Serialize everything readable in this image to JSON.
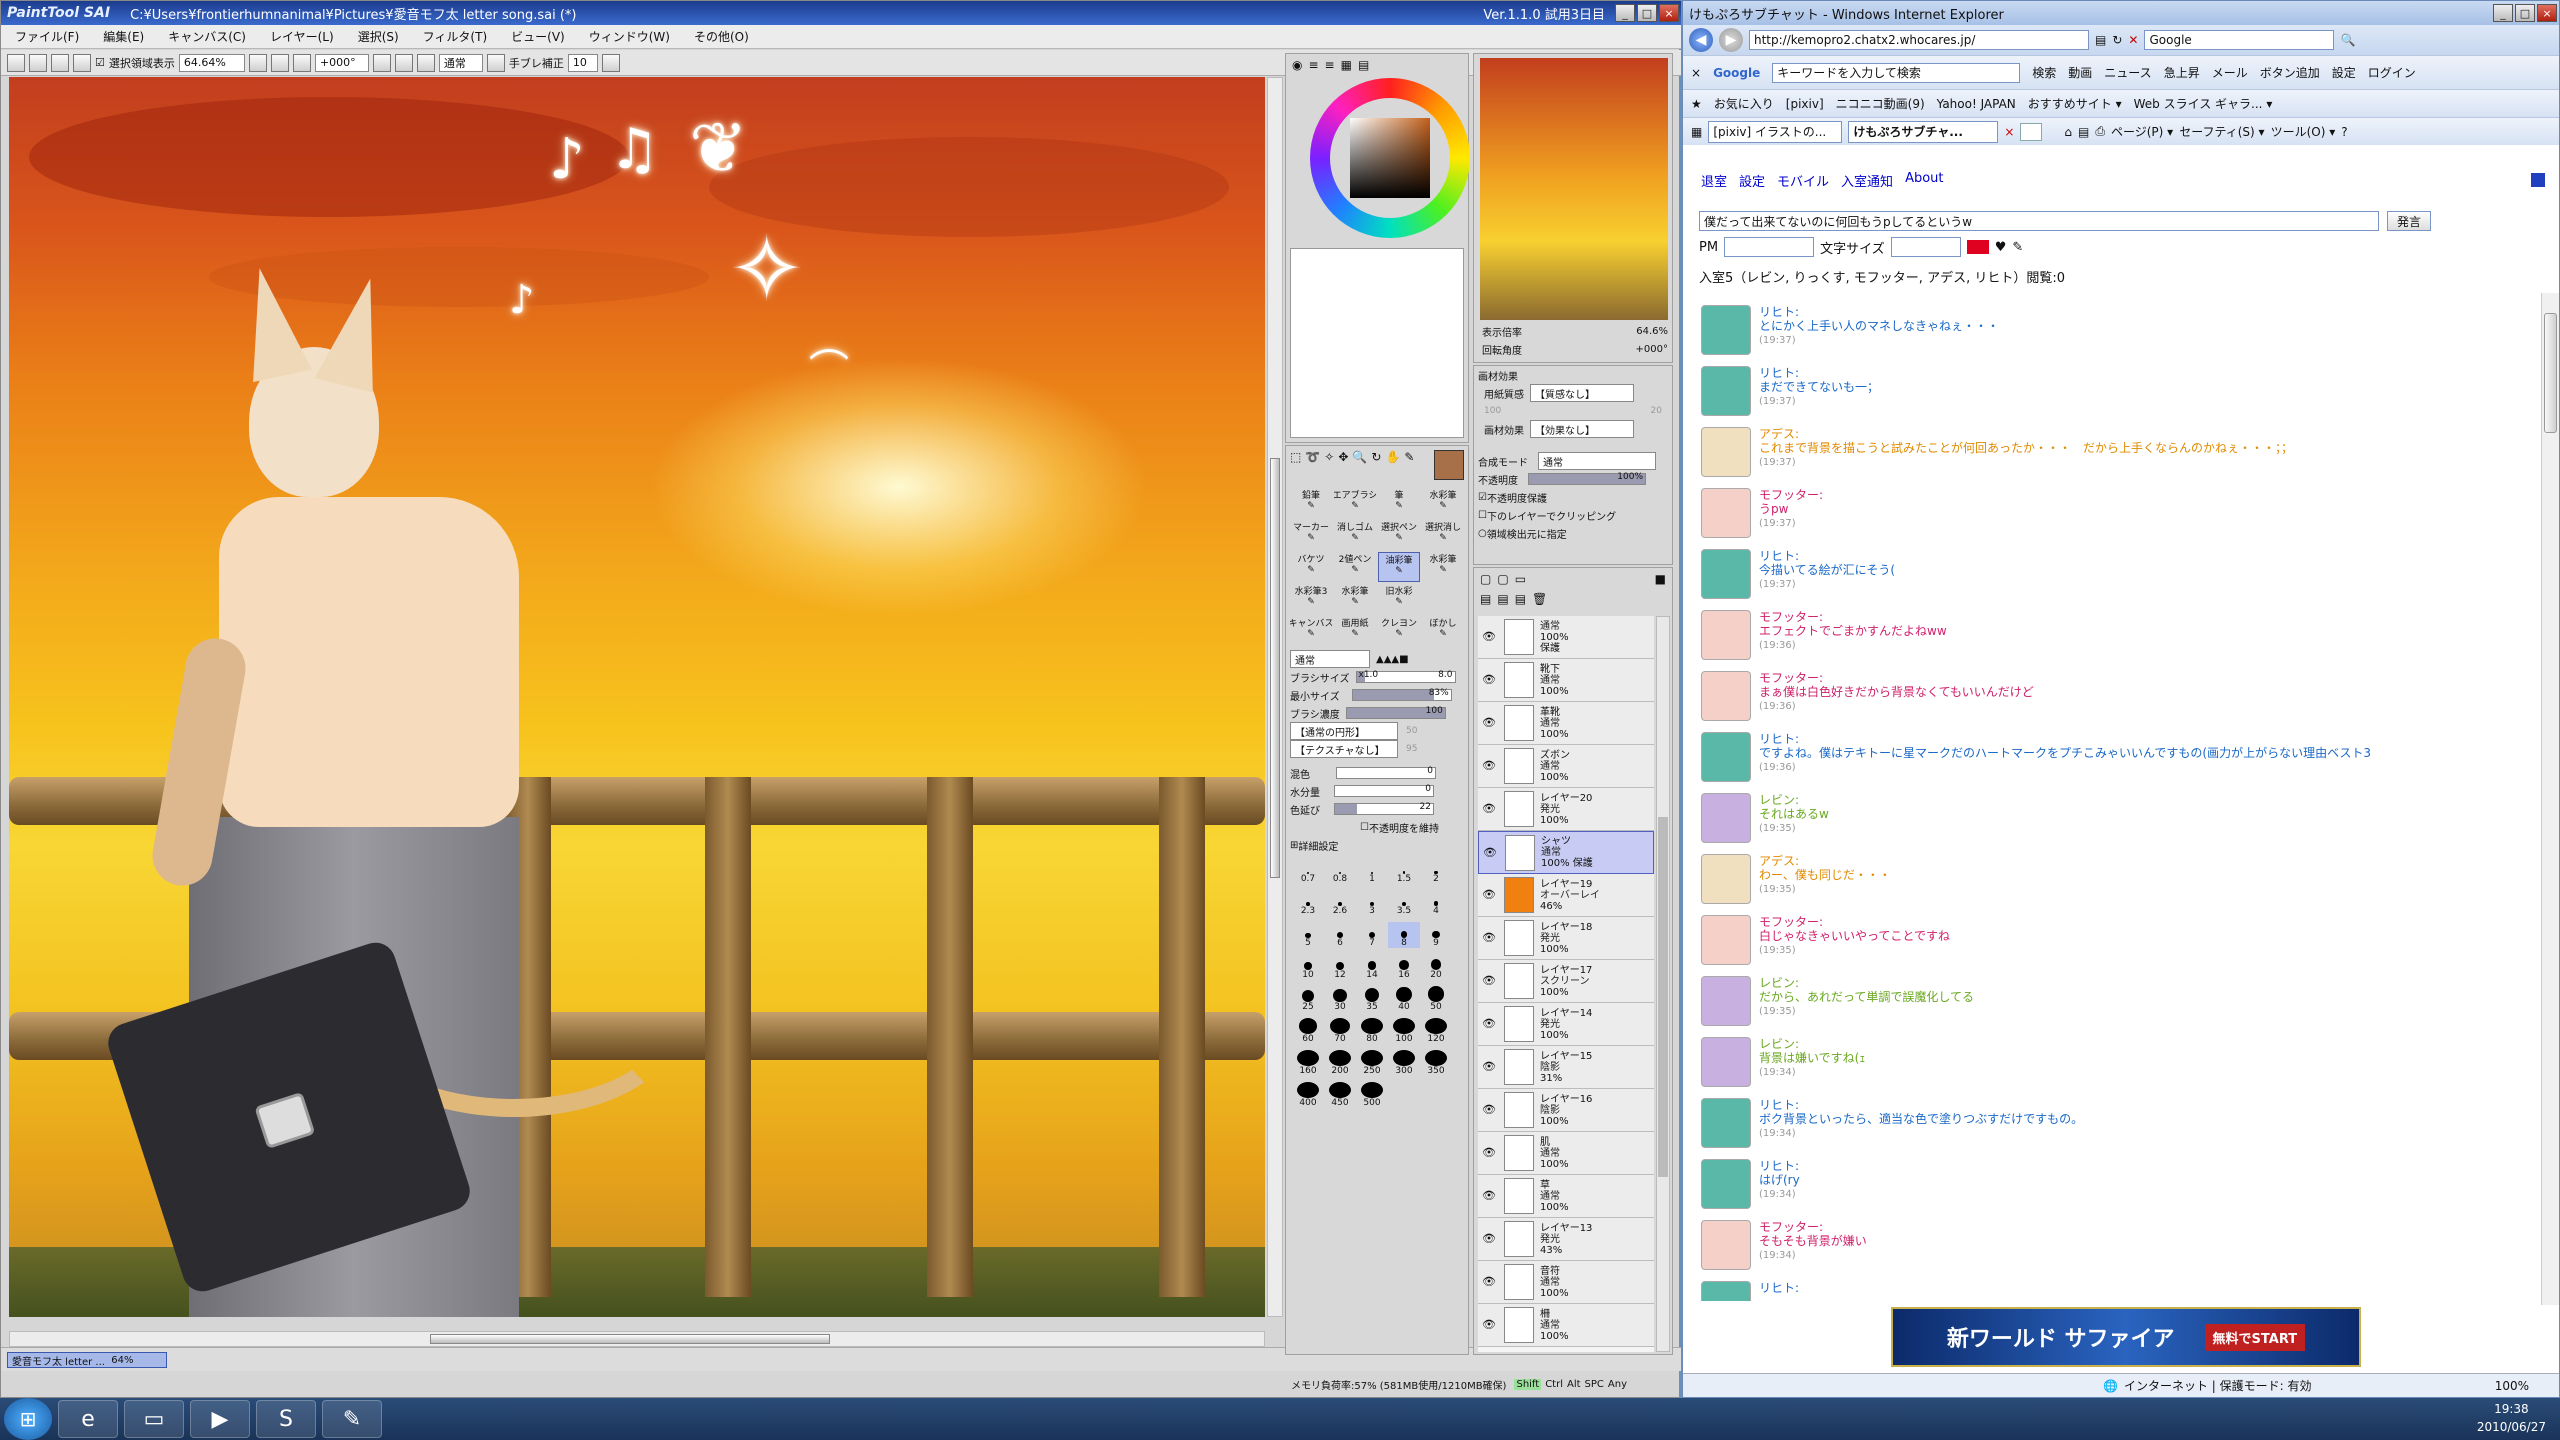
{
  "sai": {
    "logo": "PaintTool SAI",
    "path": "C:¥Users¥frontierhumnanimal¥Pictures¥愛音モフ太  letter song.sai (*)",
    "version": "Ver.1.1.0 試用3日目",
    "menu": [
      "ファイル(F)",
      "編集(E)",
      "キャンバス(C)",
      "レイヤー(L)",
      "選択(S)",
      "フィルタ(T)",
      "ビュー(V)",
      "ウィンドウ(W)",
      "その他(O)"
    ],
    "toolbar": {
      "selection_label": "選択領域表示",
      "zoom": "64.64%",
      "angle": "+000°",
      "blend": "通常",
      "stabilizer_label": "手ブレ補正",
      "stabilizer": "10"
    },
    "navigator": {
      "zoom_label": "表示倍率",
      "zoom": "64.6%",
      "angle_label": "回転角度",
      "angle": "+000°"
    },
    "texture": {
      "header": "画材効果",
      "paper_label": "用紙質感",
      "paper": "【質感なし】",
      "effect_label": "画材効果",
      "effect": "【効果なし】",
      "paper_val1": "100",
      "paper_val2": "20"
    },
    "layer_opts": {
      "blend_label": "合成モード",
      "blend": "通常",
      "opacity_label": "不透明度",
      "opacity": "100%",
      "preserve": "不透明度保護",
      "clip": "下のレイヤーでクリッピング",
      "source": "領域検出元に指定"
    },
    "tools": [
      "鉛筆",
      "エアブラシ",
      "筆",
      "水彩筆",
      "マーカー",
      "消しゴム",
      "選択ペン",
      "選択消し",
      "バケツ",
      "2値ペン",
      "油彩筆",
      "水彩筆",
      "水彩筆3",
      "水彩筆",
      "旧水彩",
      "",
      "キャンバス",
      "画用紙",
      "クレヨン",
      "ぼかし"
    ],
    "brush": {
      "mode": "通常",
      "size_label": "ブラシサイズ",
      "size_mult": "x1.0",
      "size": "8.0",
      "min_label": "最小サイズ",
      "min": "83%",
      "density_label": "ブラシ濃度",
      "density": "100",
      "shape": "【通常の円形】",
      "texture": "【テクスチャなし】",
      "shape_val": "50",
      "texture_val": "95",
      "mix_label": "混色",
      "mix": "0",
      "water_label": "水分量",
      "water": "0",
      "stretch_label": "色延び",
      "stretch": "22",
      "keep_opacity": "不透明度を維持",
      "detail": "詳細設定"
    },
    "brush_sizes": [
      "0.7",
      "0.8",
      "1",
      "1.5",
      "2",
      "2.3",
      "2.6",
      "3",
      "3.5",
      "4",
      "5",
      "6",
      "7",
      "8",
      "9",
      "10",
      "12",
      "14",
      "16",
      "20",
      "25",
      "30",
      "35",
      "40",
      "50",
      "60",
      "70",
      "80",
      "100",
      "120",
      "160",
      "200",
      "250",
      "300",
      "350",
      "400",
      "450",
      "500"
    ],
    "layers": [
      {
        "name": "",
        "mode": "通常",
        "op": "100%",
        "extra": "保護"
      },
      {
        "name": "靴下",
        "mode": "通常",
        "op": "100%"
      },
      {
        "name": "革靴",
        "mode": "通常",
        "op": "100%"
      },
      {
        "name": "ズボン",
        "mode": "通常",
        "op": "100%"
      },
      {
        "name": "レイヤー20",
        "mode": "発光",
        "op": "100%"
      },
      {
        "name": "シャツ",
        "mode": "通常",
        "op": "100% 保護",
        "sel": true
      },
      {
        "name": "レイヤー19",
        "mode": "オーバーレイ",
        "op": "46%",
        "orange": true
      },
      {
        "name": "レイヤー18",
        "mode": "発光",
        "op": "100%"
      },
      {
        "name": "レイヤー17",
        "mode": "スクリーン",
        "op": "100%"
      },
      {
        "name": "レイヤー14",
        "mode": "発光",
        "op": "100%"
      },
      {
        "name": "レイヤー15",
        "mode": "陰影",
        "op": "31%"
      },
      {
        "name": "レイヤー16",
        "mode": "陰影",
        "op": "100%"
      },
      {
        "name": "肌",
        "mode": "通常",
        "op": "100%"
      },
      {
        "name": "草",
        "mode": "通常",
        "op": "100%"
      },
      {
        "name": "レイヤー13",
        "mode": "発光",
        "op": "43%"
      },
      {
        "name": "音符",
        "mode": "通常",
        "op": "100%"
      },
      {
        "name": "柵",
        "mode": "通常",
        "op": "100%"
      }
    ],
    "doc_tab": {
      "name": "愛音モフ太  letter ...",
      "zoom": "64%"
    },
    "status": "メモリ負荷率:57% (581MB使用/1210MB確保)",
    "status_keys": [
      "Shift",
      "Ctrl",
      "Alt",
      "SPC",
      "Any"
    ]
  },
  "ie": {
    "title": "けもぷろサブチャット - Windows Internet Explorer",
    "url": "http://kemopro2.chatx2.whocares.jp/",
    "search_engine": "Google",
    "google_placeholder": "キーワードを入力して検索",
    "google_buttons": [
      "検索",
      "動画",
      "ニュース",
      "急上昇",
      "メール",
      "ボタン追加",
      "設定",
      "ログイン"
    ],
    "favorites": [
      "お気に入り",
      "[pixiv]",
      "ニコニコ動画(9)",
      "Yahoo! JAPAN",
      "おすすめサイト ▾",
      "Web スライス ギャラ... ▾"
    ],
    "tabs": [
      "[pixiv] イラストの...",
      "けもぷろサブチャ..."
    ],
    "commands": [
      "ページ(P) ▾",
      "セーフティ(S) ▾",
      "ツール(O) ▾"
    ],
    "links": [
      "退室",
      "設定",
      "モバイル",
      "入室通知",
      "About"
    ],
    "message_input": "僕だって出来てないのに何回もうpしてるというw",
    "send": "発言",
    "pm_label": "PM",
    "size_label": "文字サイズ",
    "occupants": "入室5（レビン, りっくす, モフッター, アデス, リヒト）閲覧:0",
    "messages": [
      {
        "name": "リヒト:",
        "text": "とにかく上手い人のマネしなきゃねぇ・・・",
        "time": "(19:37)",
        "color": "#1a68c8"
      },
      {
        "name": "リヒト:",
        "text": "まだできてないも一；",
        "time": "(19:37)",
        "color": "#1a68c8"
      },
      {
        "name": "アデス:",
        "text": "これまで背景を描こうと試みたことが何回あったか・・・　だから上手くならんのかねぇ・・・；；",
        "time": "(19:37)",
        "color": "#e08a00"
      },
      {
        "name": "モフッター:",
        "text": "うpw",
        "time": "(19:37)",
        "color": "#d0206a"
      },
      {
        "name": "リヒト:",
        "text": "今描いてる絵が汇にそう(",
        "time": "(19:37)",
        "color": "#1a68c8"
      },
      {
        "name": "モフッター:",
        "text": "エフェクトでごまかすんだよねww",
        "time": "(19:36)",
        "color": "#d0206a"
      },
      {
        "name": "モフッター:",
        "text": "まぁ僕は白色好きだから背景なくてもいいんだけど",
        "time": "(19:36)",
        "color": "#d0206a"
      },
      {
        "name": "リヒト:",
        "text": "ですよね。僕はテキトーに星マークだのハートマークをプチこみゃいいんですもの(画力が上がらない理由ベスト3",
        "time": "(19:36)",
        "color": "#1a68c8"
      },
      {
        "name": "レビン:",
        "text": "それはあるw",
        "time": "(19:35)",
        "color": "#6aa820"
      },
      {
        "name": "アデス:",
        "text": "わー、僕も同じだ・・・",
        "time": "(19:35)",
        "color": "#e08a00"
      },
      {
        "name": "モフッター:",
        "text": "白じゃなきゃいいやってことですね",
        "time": "(19:35)",
        "color": "#d0206a"
      },
      {
        "name": "レビン:",
        "text": "だから、あれだって単調で誤魔化してる",
        "time": "(19:35)",
        "color": "#6aa820"
      },
      {
        "name": "レビン:",
        "text": "背景は嫌いですね(ｪ",
        "time": "(19:34)",
        "color": "#6aa820"
      },
      {
        "name": "リヒト:",
        "text": "ボク背景といったら、適当な色で塗りつぶすだけですもの。",
        "time": "(19:34)",
        "color": "#1a68c8"
      },
      {
        "name": "リヒト:",
        "text": "はげ(ry",
        "time": "(19:34)",
        "color": "#1a68c8"
      },
      {
        "name": "モフッター:",
        "text": "そもそも背景が嫌い",
        "time": "(19:34)",
        "color": "#d0206a"
      },
      {
        "name": "リヒト:",
        "text": "",
        "time": "",
        "color": "#1a68c8"
      }
    ],
    "ad": "新ワールド サファイア",
    "ad_badge": "無料でSTART",
    "status_zone": "インターネット | 保護モード: 有効",
    "status_zoom": "100%"
  },
  "taskbar": {
    "time": "19:38",
    "date": "2010/06/27"
  }
}
